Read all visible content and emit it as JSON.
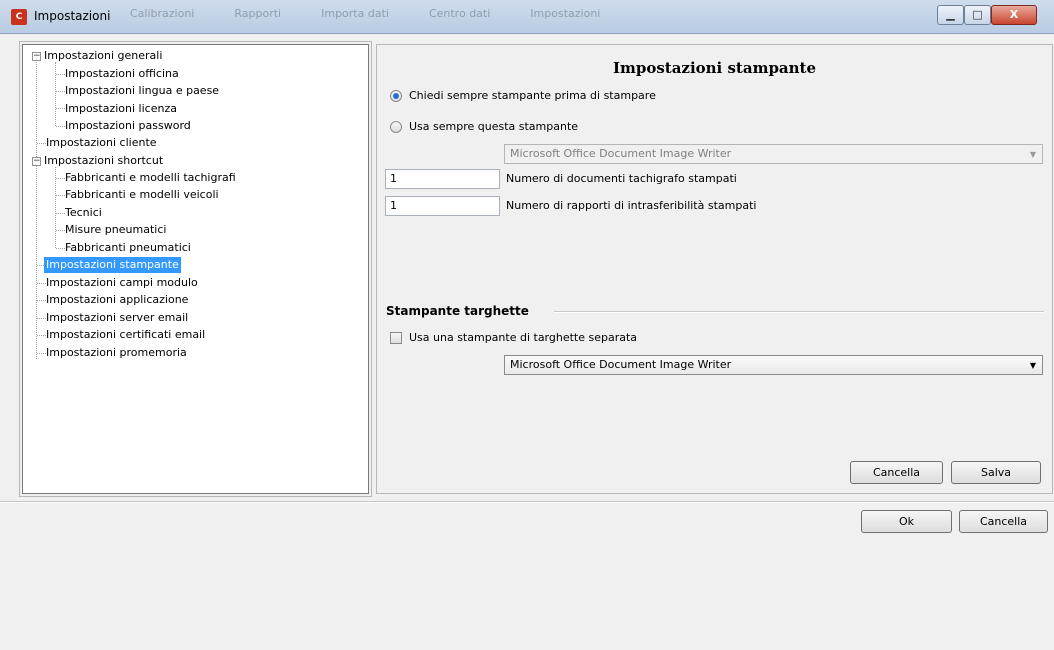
{
  "window": {
    "title": "Impostazioni",
    "background_tabs": [
      "Calibrazioni",
      "Rapporti",
      "Importa dati",
      "Centro dati",
      "Impostazioni"
    ],
    "close_label": "X"
  },
  "tree": {
    "nodes": [
      {
        "label": "Impostazioni generali"
      },
      {
        "label": "Impostazioni officina"
      },
      {
        "label": "Impostazioni lingua e paese"
      },
      {
        "label": "Impostazioni licenza"
      },
      {
        "label": "Impostazioni password"
      },
      {
        "label": "Impostazioni cliente"
      },
      {
        "label": "Impostazioni shortcut"
      },
      {
        "label": "Fabbricanti e modelli tachigrafi"
      },
      {
        "label": "Fabbricanti e modelli veicoli"
      },
      {
        "label": "Tecnici"
      },
      {
        "label": "Misure pneumatici"
      },
      {
        "label": "Fabbricanti pneumatici"
      },
      {
        "label": "Impostazioni stampante",
        "selected": true
      },
      {
        "label": "Impostazioni campi modulo"
      },
      {
        "label": "Impostazioni applicazione"
      },
      {
        "label": "Impostazioni server email"
      },
      {
        "label": "Impostazioni certificati email"
      },
      {
        "label": "Impostazioni promemoria"
      }
    ]
  },
  "printer_settings": {
    "title": "Impostazioni stampante",
    "radio_ask": {
      "label": "Chiedi sempre stampante prima di stampare",
      "checked": true
    },
    "radio_always": {
      "label": "Usa sempre questa stampante",
      "checked": false
    },
    "printer_select": {
      "value": "Microsoft Office Document Image Writer",
      "enabled": false
    },
    "tachograph_copies": {
      "value": "1",
      "label": "Numero di documenti tachigrafo stampati"
    },
    "nontransferability_copies": {
      "value": "1",
      "label": "Numero di rapporti di intrasferibilità stampati"
    }
  },
  "label_printer": {
    "section_title": "Stampante targhette",
    "checkbox": {
      "label": "Usa una stampante di targhette separata",
      "checked": false
    },
    "printer_select": {
      "value": "Microsoft Office Document Image Writer"
    }
  },
  "panel_buttons": {
    "cancel": "Cancella",
    "save": "Salva"
  },
  "dialog_buttons": {
    "ok": "Ok",
    "cancel": "Cancella"
  }
}
